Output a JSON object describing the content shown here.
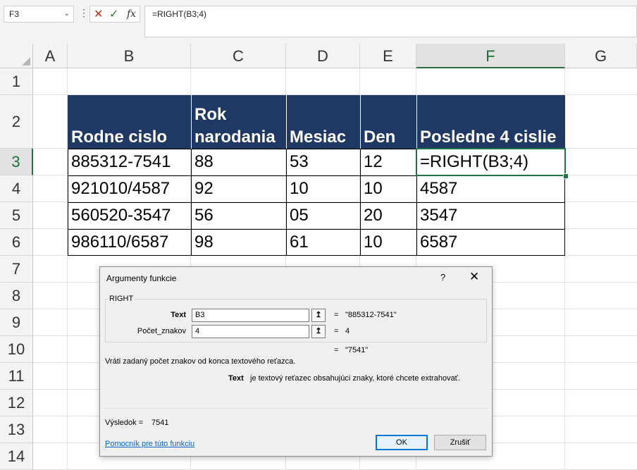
{
  "formula_bar": {
    "name_box": "F3",
    "formula": "=RIGHT(B3;4)",
    "fx_label": "fx"
  },
  "columns": [
    "A",
    "B",
    "C",
    "D",
    "E",
    "F",
    "G"
  ],
  "selected_column": "F",
  "rows": [
    "1",
    "2",
    "3",
    "4",
    "5",
    "6",
    "7",
    "8",
    "9",
    "10",
    "11",
    "12",
    "13",
    "14"
  ],
  "selected_row": "3",
  "table": {
    "headers": [
      "Rodne cislo",
      "Rok\nnarodania",
      "Mesiac",
      "Den",
      "Posledne 4 cislie"
    ],
    "rows": [
      [
        "885312-7541",
        "88",
        "53",
        "12",
        "=RIGHT(B3;4)"
      ],
      [
        "921010/4587",
        "92",
        "10",
        "10",
        "4587"
      ],
      [
        "560520-3547",
        "56",
        "05",
        "20",
        "3547"
      ],
      [
        "986110/6587",
        "98",
        "61",
        "10",
        "6587"
      ]
    ],
    "header_bg": "#1f3864"
  },
  "dialog": {
    "title": "Argumenty funkcie",
    "help_glyph": "?",
    "close_glyph": "✕",
    "function_name": "RIGHT",
    "args": [
      {
        "label": "Text",
        "value": "B3",
        "result": "\"885312-7541\"",
        "bold": true
      },
      {
        "label": "Počet_znakov",
        "value": "4",
        "result": "4",
        "bold": false
      }
    ],
    "eq": "=",
    "formula_result": "\"7541\"",
    "description": "Vráti zadaný počet znakov od konca textového reťazca.",
    "arg_help_name": "Text",
    "arg_help_text": "je textový reťazec obsahujúci znaky, ktoré chcete extrahovať.",
    "result_label": "Výsledok =",
    "result_value": "7541",
    "help_link": "Pomocník pre túto funkciu",
    "ok_label": "OK",
    "cancel_label": "Zrušiť"
  }
}
